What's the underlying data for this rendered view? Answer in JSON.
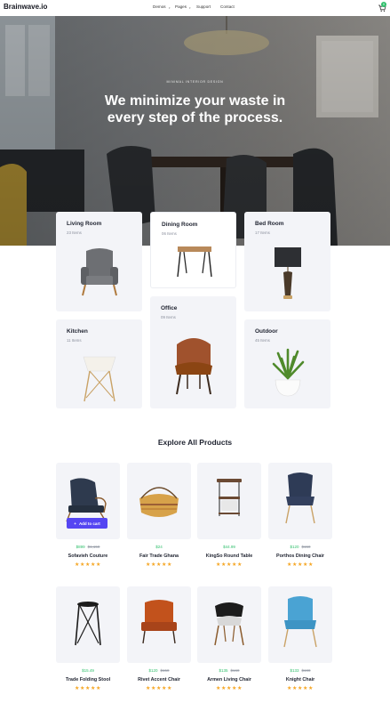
{
  "brand": {
    "name": "Brainwave.io"
  },
  "nav": {
    "items": [
      "Demos",
      "Pages",
      "Support",
      "Contact"
    ]
  },
  "cart": {
    "count": "0"
  },
  "hero": {
    "eyebrow": "MINIMAL INTERIOR DESIGN",
    "title": "We minimize your waste in every step of the process."
  },
  "categories": [
    {
      "name": "Living Room",
      "count": "23 Items"
    },
    {
      "name": "Dining Room",
      "count": "06 Items"
    },
    {
      "name": "Bed Room",
      "count": "17 Items"
    },
    {
      "name": "Office",
      "count": "09 Items"
    },
    {
      "name": "Kitchen",
      "count": "11 Items"
    },
    {
      "name": "Outdoor",
      "count": "45 Items"
    }
  ],
  "products_section": {
    "title": "Explore All Products",
    "add_to_cart_label": "Add to cart"
  },
  "products": [
    {
      "name": "Sofavieh Couture",
      "price": "$899",
      "old_price": "$1,150",
      "rating": 5
    },
    {
      "name": "Fair Trade Ghana",
      "price": "$24",
      "old_price": "",
      "rating": 5
    },
    {
      "name": "KingSo Round Table",
      "price": "$44.99",
      "old_price": "",
      "rating": 5
    },
    {
      "name": "Porthos Dining Chair",
      "price": "$120",
      "old_price": "$150",
      "rating": 5
    },
    {
      "name": "Trade Folding Stool",
      "price": "$15.49",
      "old_price": "",
      "rating": 5
    },
    {
      "name": "Rivet Accent Chair",
      "price": "$120",
      "old_price": "$150",
      "rating": 5
    },
    {
      "name": "Armen Living Chair",
      "price": "$135",
      "old_price": "$160",
      "rating": 5
    },
    {
      "name": "Knight Chair",
      "price": "$133",
      "old_price": "$190",
      "rating": 5
    }
  ],
  "colors": {
    "accent": "#5546f2",
    "price": "#2fbf6b",
    "star": "#f5a623",
    "card": "#f3f4f8"
  },
  "icons": [
    "cart-icon",
    "plus-icon",
    "star-icon"
  ]
}
